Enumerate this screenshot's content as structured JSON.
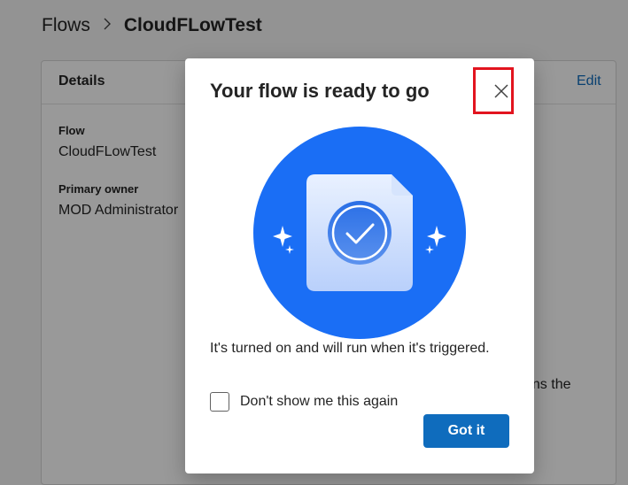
{
  "breadcrumb": {
    "parent": "Flows",
    "separator": ">",
    "current": "CloudFLowTest"
  },
  "details": {
    "title": "Details",
    "edit_label": "Edit",
    "flow_label": "Flow",
    "flow_value": "CloudFLowTest",
    "owner_label": "Primary owner",
    "owner_value": "MOD Administrator",
    "partial_text": "uns the"
  },
  "dialog": {
    "title": "Your flow is ready to go",
    "close_icon": "close-icon",
    "illustration_icon": "document-check-icon",
    "message": "It's turned on and will run when it's triggered.",
    "checkbox_label": "Don't show me this again",
    "checkbox_checked": false,
    "primary_button": "Got it"
  },
  "colors": {
    "accent": "#0f6cbd",
    "illustration_blue": "#1a6ef5",
    "highlight_red": "#e2141f"
  }
}
